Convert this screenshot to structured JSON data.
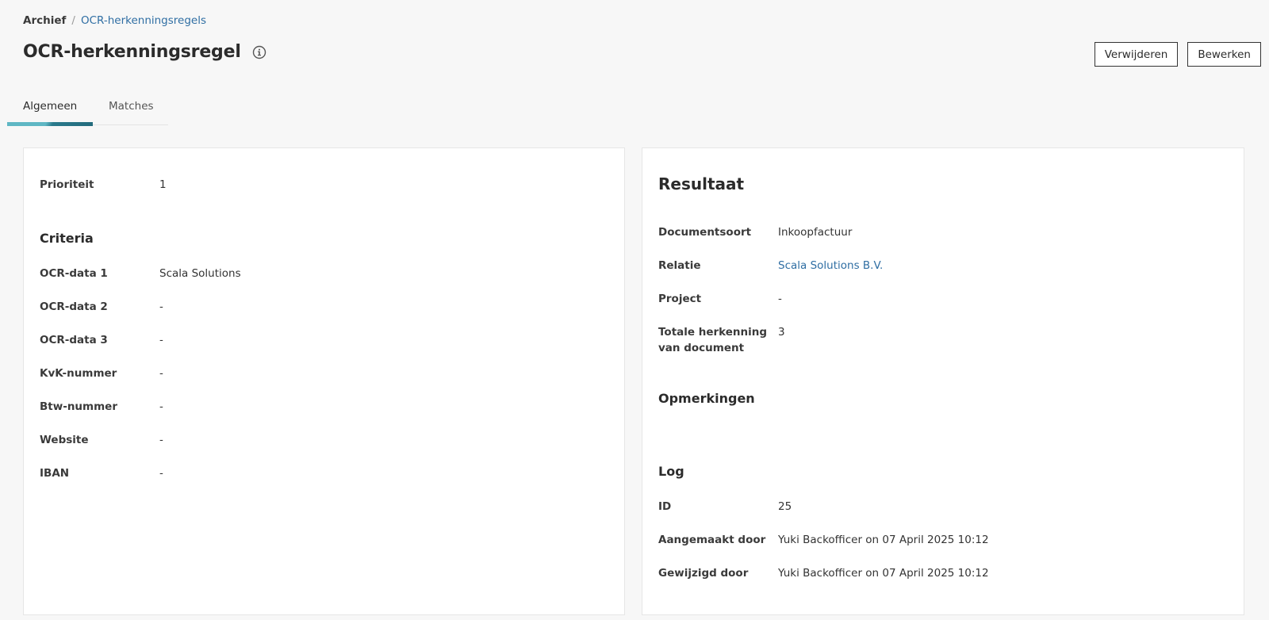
{
  "breadcrumb": {
    "root": "Archief",
    "separator": "/",
    "current": "OCR-herkenningsregels"
  },
  "header": {
    "title": "OCR-herkenningsregel",
    "info_icon": "info-circle-icon"
  },
  "actions": {
    "delete_label": "Verwijderen",
    "edit_label": "Bewerken"
  },
  "tabs": [
    {
      "label": "Algemeen",
      "active": true
    },
    {
      "label": "Matches",
      "active": false
    }
  ],
  "colors": {
    "link": "#2f6ea3",
    "tab_accent_light": "#5fb7c4",
    "tab_accent_dark": "#236b7c"
  },
  "left": {
    "priority": {
      "label": "Prioriteit",
      "value": "1"
    },
    "criteria_heading": "Criteria",
    "criteria": [
      {
        "label": "OCR-data 1",
        "value": "Scala Solutions"
      },
      {
        "label": "OCR-data 2",
        "value": "-"
      },
      {
        "label": "OCR-data 3",
        "value": "-"
      },
      {
        "label": "KvK-nummer",
        "value": "-"
      },
      {
        "label": "Btw-nummer",
        "value": "-"
      },
      {
        "label": "Website",
        "value": "-"
      },
      {
        "label": "IBAN",
        "value": "-"
      }
    ]
  },
  "right": {
    "result_heading": "Resultaat",
    "result": [
      {
        "label": "Documentsoort",
        "value": "Inkoopfactuur"
      },
      {
        "label": "Relatie",
        "value": "Scala Solutions B.V."
      },
      {
        "label": "Project",
        "value": "-"
      },
      {
        "label_line1": "Totale herkenning",
        "label_line2": "van document",
        "value": "3"
      }
    ],
    "remarks_heading": "Opmerkingen",
    "log_heading": "Log",
    "log": [
      {
        "label": "ID",
        "value": "25"
      },
      {
        "label": "Aangemaakt door",
        "value": "Yuki Backofficer on 07 April 2025 10:12"
      },
      {
        "label": "Gewijzigd door",
        "value": "Yuki Backofficer on 07 April 2025 10:12"
      }
    ]
  }
}
